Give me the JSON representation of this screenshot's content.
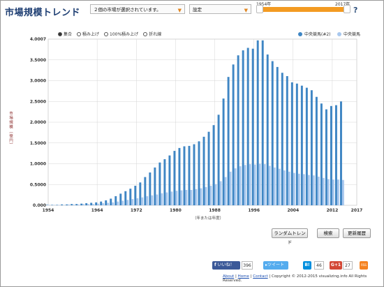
{
  "app": {
    "title": "市場規模トレンド"
  },
  "toolbar": {
    "market_select": "２個の市場が選択されています。",
    "settings_select": "設定",
    "slider_min_label": "1954年",
    "slider_max_label": "2017年",
    "help": "?"
  },
  "mode_options": [
    {
      "label": "集合",
      "selected": true
    },
    {
      "label": "積み上げ",
      "selected": false
    },
    {
      "label": "100%積み上げ",
      "selected": false
    },
    {
      "label": "折れ線",
      "selected": false
    }
  ],
  "axis_text": {
    "y_unit": "市場規模（億円）",
    "x_unit": "（年または年度）"
  },
  "chart_data": {
    "type": "bar",
    "ylabel": "市場規模（億円）",
    "xlabel": "（年または年度）",
    "ylim": [
      0,
      4.0007
    ],
    "xlim": [
      1954,
      2017
    ],
    "y_ticks": [
      "0.000",
      "0.5000",
      "1.0000",
      "1.5000",
      "2.0000",
      "2.5000",
      "3.0000",
      "3.5000",
      "4.0007"
    ],
    "x_ticks": [
      "1954",
      "1964",
      "1972",
      "1980",
      "1988",
      "1996",
      "2004",
      "2012",
      "2017"
    ],
    "legend": "top-right",
    "grid": true,
    "x": [
      1954,
      1955,
      1956,
      1957,
      1958,
      1959,
      1960,
      1961,
      1962,
      1963,
      1964,
      1965,
      1966,
      1967,
      1968,
      1969,
      1970,
      1971,
      1972,
      1973,
      1974,
      1975,
      1976,
      1977,
      1978,
      1979,
      1980,
      1981,
      1982,
      1983,
      1984,
      1985,
      1986,
      1987,
      1988,
      1989,
      1990,
      1991,
      1992,
      1993,
      1994,
      1995,
      1996,
      1997,
      1998,
      1999,
      2000,
      2001,
      2002,
      2003,
      2004,
      2005,
      2006,
      2007,
      2008,
      2009,
      2010,
      2011,
      2012,
      2013,
      2014
    ],
    "series": [
      {
        "name": "中央競馬(#2)",
        "color": "#3f86c4",
        "values": [
          0.01,
          0.01,
          0.01,
          0.02,
          0.02,
          0.03,
          0.03,
          0.04,
          0.05,
          0.06,
          0.07,
          0.09,
          0.12,
          0.16,
          0.22,
          0.28,
          0.34,
          0.4,
          0.47,
          0.55,
          0.68,
          0.79,
          0.91,
          1.03,
          1.11,
          1.2,
          1.31,
          1.38,
          1.42,
          1.43,
          1.47,
          1.54,
          1.65,
          1.77,
          1.93,
          2.18,
          2.57,
          3.09,
          3.39,
          3.61,
          3.73,
          3.79,
          3.77,
          3.97,
          3.97,
          3.63,
          3.47,
          3.33,
          3.19,
          3.11,
          2.96,
          2.93,
          2.88,
          2.83,
          2.77,
          2.61,
          2.45,
          2.31,
          2.39,
          2.41,
          2.5
        ]
      },
      {
        "name": "中央競馬",
        "color": "#a9c8ee",
        "values": [
          0.01,
          0.01,
          0.01,
          0.01,
          0.02,
          0.02,
          0.02,
          0.03,
          0.03,
          0.03,
          0.04,
          0.05,
          0.06,
          0.07,
          0.09,
          0.11,
          0.13,
          0.15,
          0.17,
          0.19,
          0.22,
          0.24,
          0.26,
          0.29,
          0.31,
          0.33,
          0.35,
          0.36,
          0.37,
          0.37,
          0.39,
          0.41,
          0.44,
          0.47,
          0.51,
          0.58,
          0.68,
          0.81,
          0.89,
          0.94,
          0.97,
          0.99,
          0.98,
          1.0,
          0.99,
          0.95,
          0.91,
          0.88,
          0.84,
          0.81,
          0.78,
          0.76,
          0.75,
          0.73,
          0.72,
          0.69,
          0.66,
          0.63,
          0.62,
          0.62,
          0.61
        ]
      }
    ]
  },
  "buttons": {
    "random": "ランダムトレンド",
    "search": "検索",
    "history": "更新履歴"
  },
  "social": {
    "like": "いいね！",
    "like_count": "396",
    "tweet": "ツイート",
    "hatena": "B!",
    "hatena_count": "46",
    "gplus": "G+1",
    "gplus_count": "27",
    "rss": "RSS"
  },
  "footer": {
    "about": "About",
    "home": "Home",
    "contact": "Contact",
    "copyright": "Copyright © 2012-2015 visualizing.info All Rights Reserved."
  }
}
